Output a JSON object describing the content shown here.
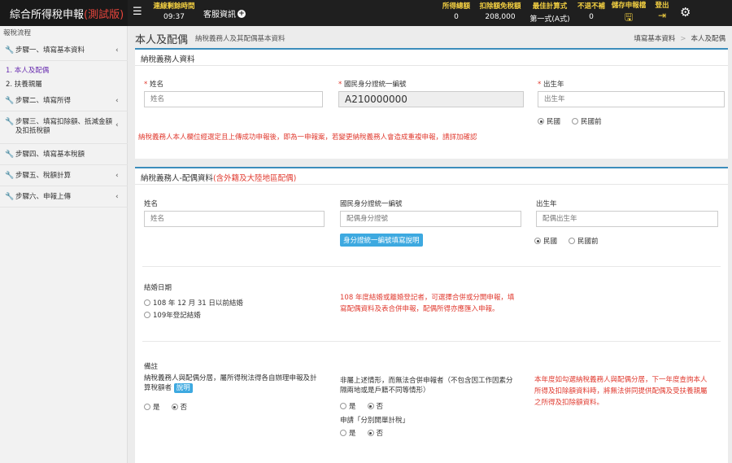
{
  "app": {
    "title": "綜合所得稅申報",
    "test_tag": "(測試版)"
  },
  "topbar": {
    "timer_label": "連線剩餘時間",
    "timer_value": "09:37",
    "service_label": "客服資訊",
    "stats": [
      {
        "label": "所得總額",
        "value": "0"
      },
      {
        "label": "扣除額免稅額",
        "value": "208,000"
      },
      {
        "label": "最佳計算式",
        "value": "第一式(A式)"
      },
      {
        "label": "不退不補",
        "value": "0"
      }
    ],
    "save_label": "儲存申報檔",
    "logout_label": "登出"
  },
  "sidebar": {
    "title": "報稅流程",
    "steps": [
      {
        "label": "步驟一、填寫基本資料"
      },
      {
        "label": "步驟二、填寫所得"
      },
      {
        "label": "步驟三、填寫扣除額、抵減金額",
        "label2": "及扣抵稅額"
      },
      {
        "label": "步驟四、填寫基本稅額"
      },
      {
        "label": "步驟五、稅額計算"
      },
      {
        "label": "步驟六、申報上傳"
      }
    ],
    "subs": [
      {
        "label": "1. 本人及配偶"
      },
      {
        "label": "2. 扶養親屬"
      }
    ]
  },
  "page": {
    "title": "本人及配偶",
    "subtitle": "納稅義務人及其配偶基本資料",
    "breadcrumb": [
      "填寫基本資料",
      "本人及配偶"
    ]
  },
  "taxpayer": {
    "heading": "納稅義務人資料",
    "name_label": "姓名",
    "name_placeholder": "姓名",
    "id_label": "國民身分證統一編號",
    "id_value": "A210000000",
    "birth_label": "出生年",
    "birth_placeholder": "出生年",
    "era_roc": "民國",
    "era_before": "民國前",
    "warning": "納稅義務人本人欄位經選定且上傳成功申報後，即為一申報案，若變更納稅義務人會造成重複申報，請詳加確認"
  },
  "spouse": {
    "heading": "納稅義務人-配偶資料",
    "heading_note": "(含外籍及大陸地區配偶)",
    "name_label": "姓名",
    "name_placeholder": "姓名",
    "id_label": "國民身分證統一編號",
    "id_placeholder": "配偶身分證號",
    "id_help_button": "身分證統一編號填寫說明",
    "birth_label": "出生年",
    "birth_placeholder": "配偶出生年",
    "era_roc": "民國",
    "era_before": "民國前",
    "marriage_label": "結婚日期",
    "marriage_opt1": "108 年 12 月 31 日以前結婚",
    "marriage_opt2": "109年登記結婚",
    "marriage_warn_line1": "108 年度結婚或離婚登記者，可選擇合併或分開申報，填",
    "marriage_warn_line2": "寫配偶資料及表合併申報，配偶所得亦應匯入申報。",
    "remark_label": "備註",
    "remark1_line1": "納稅義務人與配偶分居，屬所得稅法得各自辦理申報及計",
    "remark1_line2": "算稅額者",
    "explain_button": "說明",
    "yes": "是",
    "no": "否",
    "remark2_line1": "非屬上述情形，而無法合併申報者（不包含因工作因素分",
    "remark2_line2": "隔兩地或是戶籍不同等情形）",
    "separate_label": "申請「分別開單計稅」",
    "remark_warn_line1": "本年度如勾選納稅義務人與配偶分居，下一年度查詢本人",
    "remark_warn_line2": "所得及扣除額資料時，將無法併同提供配偶及受扶養親屬",
    "remark_warn_line3": "之所得及扣除額資料。"
  }
}
